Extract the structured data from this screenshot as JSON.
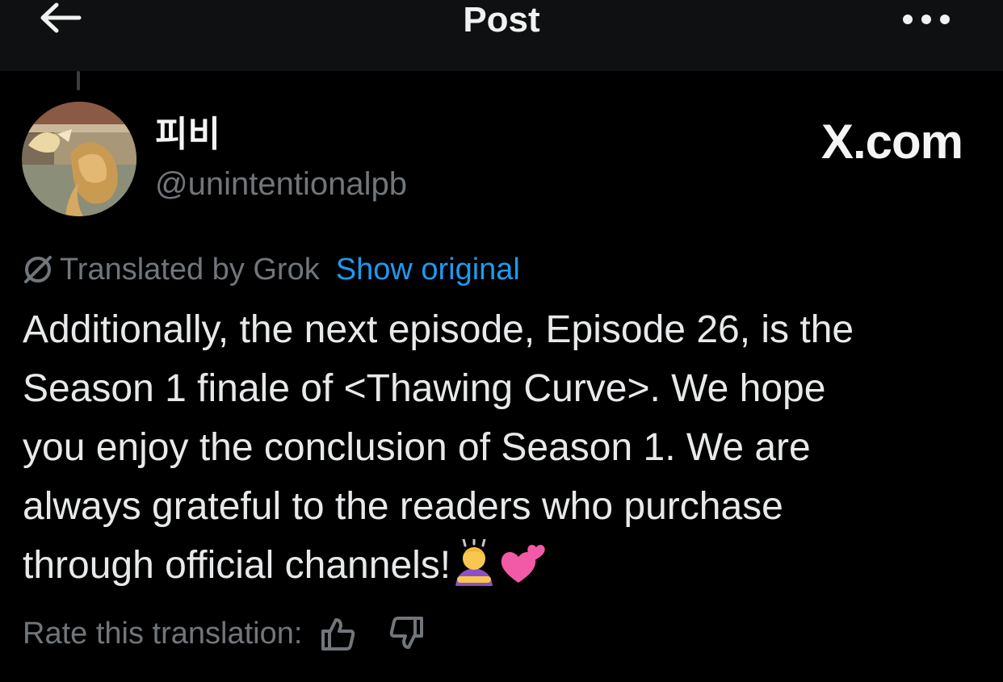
{
  "header": {
    "title": "Post",
    "back_icon": "arrow-left-icon",
    "more_icon": "more-horizontal-icon"
  },
  "author": {
    "display_name": "피비",
    "handle": "@unintentionalpb",
    "avatar_icon": "avatar-image"
  },
  "watermark": "X.com",
  "translation": {
    "label": "Translated by Grok",
    "show_original": "Show original",
    "icon": "grok-icon"
  },
  "post": {
    "text": "Additionally, the next episode, Episode 26, is the\nSeason 1 finale of <Thawing Curve>. We hope\nyou enjoy the conclusion of Season 1. We are\nalways grateful to the readers who purchase\nthrough official channels!",
    "emojis": [
      "person-bowing-emoji",
      "two-hearts-emoji"
    ]
  },
  "rate": {
    "label": "Rate this translation:",
    "thumbs_up_icon": "thumbs-up-icon",
    "thumbs_down_icon": "thumbs-down-icon"
  },
  "colors": {
    "background": "#000000",
    "header_bg": "#0f1011",
    "text": "#e7e9ea",
    "secondary": "#71767b",
    "link": "#1d9bf0"
  }
}
